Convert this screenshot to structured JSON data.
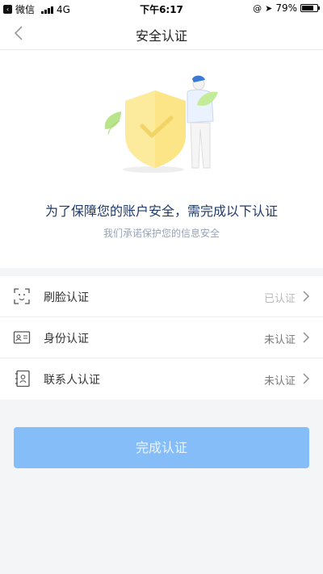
{
  "status_bar": {
    "back_app": "微信",
    "network": "4G",
    "time": "下午6:17",
    "battery": "79%",
    "battery_level": 0.79
  },
  "nav": {
    "title": "安全认证",
    "back_icon": "chevron-left-icon"
  },
  "hero": {
    "title": "为了保障您的账户安全，需完成以下认证",
    "subtitle": "我们承诺保护您的信息安全"
  },
  "items": [
    {
      "icon": "face-scan-icon",
      "label": "刷脸认证",
      "status": "已认证",
      "verified": true
    },
    {
      "icon": "id-card-icon",
      "label": "身份认证",
      "status": "未认证",
      "verified": false
    },
    {
      "icon": "contact-card-icon",
      "label": "联系人认证",
      "status": "未认证",
      "verified": false
    }
  ],
  "submit_button": "完成认证",
  "colors": {
    "accent_button": "#85bdf8",
    "hero_title": "#1f3a6b",
    "hero_subtitle": "#98a3b8",
    "shield": "#fdeb9d",
    "leaf": "#b8e58b",
    "person": "#3b79d6"
  }
}
